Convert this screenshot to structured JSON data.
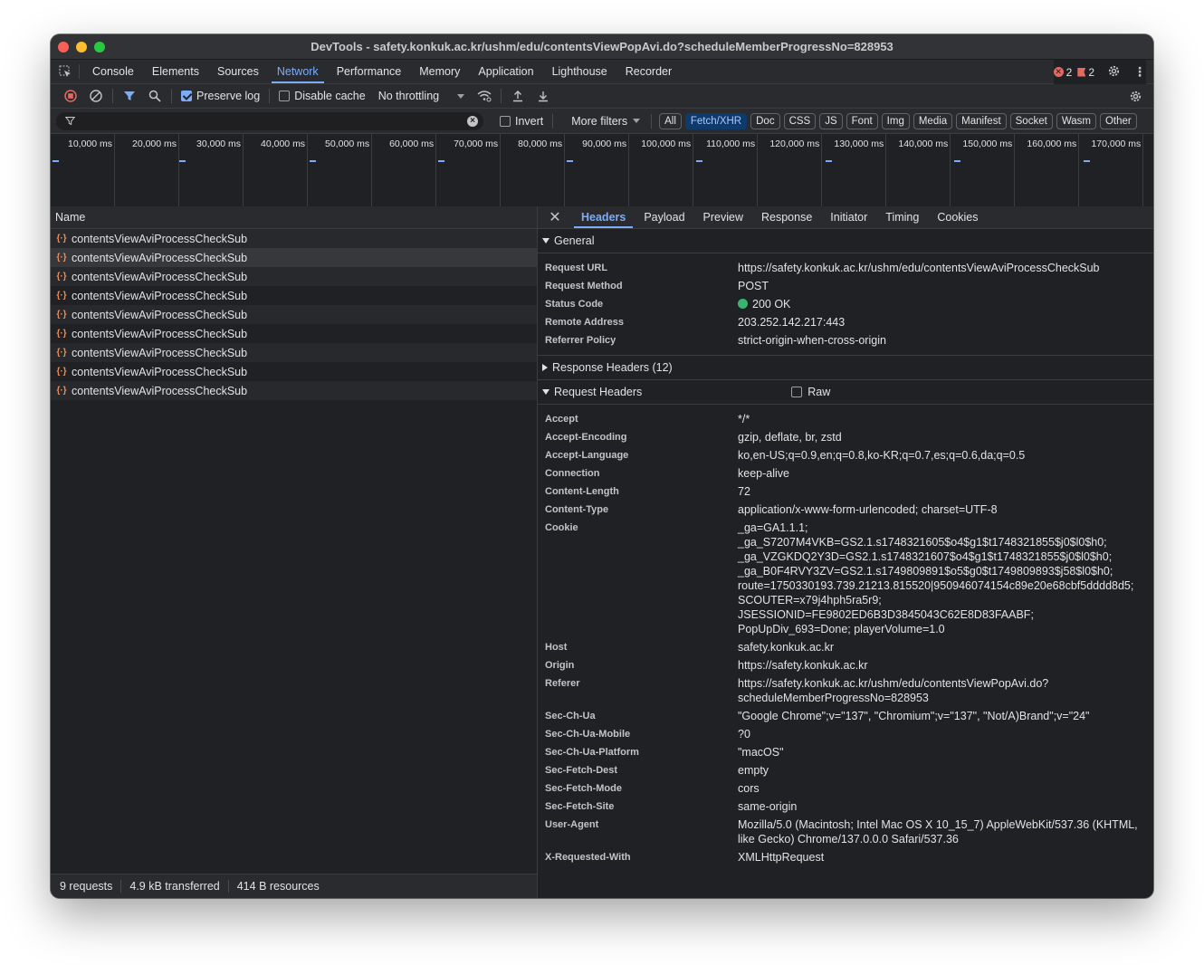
{
  "window": {
    "title": "DevTools - safety.konkuk.ac.kr/ushm/edu/contentsViewPopAvi.do?scheduleMemberProgressNo=828953"
  },
  "tabs": [
    "Console",
    "Elements",
    "Sources",
    "Network",
    "Performance",
    "Memory",
    "Application",
    "Lighthouse",
    "Recorder"
  ],
  "active_tab": "Network",
  "issues": {
    "errors": "2",
    "warnings": "2"
  },
  "toolbar": {
    "preserve_log": "Preserve log",
    "disable_cache": "Disable cache",
    "throttling": "No throttling"
  },
  "filter": {
    "placeholder": "",
    "invert": "Invert",
    "more_filters": "More filters",
    "chips": [
      "All",
      "Fetch/XHR",
      "Doc",
      "CSS",
      "JS",
      "Font",
      "Img",
      "Media",
      "Manifest",
      "Socket",
      "Wasm",
      "Other"
    ],
    "active_chip": "Fetch/XHR"
  },
  "overview": {
    "ticks": [
      "10,000 ms",
      "20,000 ms",
      "30,000 ms",
      "40,000 ms",
      "50,000 ms",
      "60,000 ms",
      "70,000 ms",
      "80,000 ms",
      "90,000 ms",
      "100,000 ms",
      "110,000 ms",
      "120,000 ms",
      "130,000 ms",
      "140,000 ms",
      "150,000 ms",
      "160,000 ms",
      "170,000 ms"
    ]
  },
  "requests": {
    "column_name": "Name",
    "items": [
      "contentsViewAviProcessCheckSub",
      "contentsViewAviProcessCheckSub",
      "contentsViewAviProcessCheckSub",
      "contentsViewAviProcessCheckSub",
      "contentsViewAviProcessCheckSub",
      "contentsViewAviProcessCheckSub",
      "contentsViewAviProcessCheckSub",
      "contentsViewAviProcessCheckSub",
      "contentsViewAviProcessCheckSub"
    ],
    "selected_index": 1
  },
  "status": {
    "requests": "9 requests",
    "transferred": "4.9 kB transferred",
    "resources": "414 B resources"
  },
  "detail_tabs": [
    "Headers",
    "Payload",
    "Preview",
    "Response",
    "Initiator",
    "Timing",
    "Cookies"
  ],
  "active_detail_tab": "Headers",
  "general": {
    "title": "General",
    "rows": [
      {
        "k": "Request URL",
        "v": "https://safety.konkuk.ac.kr/ushm/edu/contentsViewAviProcessCheckSub"
      },
      {
        "k": "Request Method",
        "v": "POST"
      },
      {
        "k": "Status Code",
        "v": "200 OK"
      },
      {
        "k": "Remote Address",
        "v": "203.252.142.217:443"
      },
      {
        "k": "Referrer Policy",
        "v": "strict-origin-when-cross-origin"
      }
    ]
  },
  "response_headers": {
    "title": "Response Headers (12)"
  },
  "request_headers": {
    "title": "Request Headers",
    "raw": "Raw",
    "rows": [
      {
        "k": "Accept",
        "v": "*/*"
      },
      {
        "k": "Accept-Encoding",
        "v": "gzip, deflate, br, zstd"
      },
      {
        "k": "Accept-Language",
        "v": "ko,en-US;q=0.9,en;q=0.8,ko-KR;q=0.7,es;q=0.6,da;q=0.5"
      },
      {
        "k": "Connection",
        "v": "keep-alive"
      },
      {
        "k": "Content-Length",
        "v": "72"
      },
      {
        "k": "Content-Type",
        "v": "application/x-www-form-urlencoded; charset=UTF-8"
      },
      {
        "k": "Cookie",
        "v": "_ga=GA1.1.1;\n_ga_S7207M4VKB=GS2.1.s1748321605$o4$g1$t1748321855$j0$l0$h0;\n_ga_VZGKDQ2Y3D=GS2.1.s1748321607$o4$g1$t1748321855$j0$l0$h0;\n_ga_B0F4RVY3ZV=GS2.1.s1749809891$o5$g0$t1749809893$j58$l0$h0;\nroute=1750330193.739.21213.815520|950946074154c89e20e68cbf5dddd8d5; SCOUTER=x79j4hph5ra5r9;\nJSESSIONID=FE9802ED6B3D3845043C62E8D83FAABF;\nPopUpDiv_693=Done; playerVolume=1.0"
      },
      {
        "k": "Host",
        "v": "safety.konkuk.ac.kr"
      },
      {
        "k": "Origin",
        "v": "https://safety.konkuk.ac.kr"
      },
      {
        "k": "Referer",
        "v": "https://safety.konkuk.ac.kr/ushm/edu/contentsViewPopAvi.do?\nscheduleMemberProgressNo=828953"
      },
      {
        "k": "Sec-Ch-Ua",
        "v": "\"Google Chrome\";v=\"137\", \"Chromium\";v=\"137\", \"Not/A)Brand\";v=\"24\""
      },
      {
        "k": "Sec-Ch-Ua-Mobile",
        "v": "?0"
      },
      {
        "k": "Sec-Ch-Ua-Platform",
        "v": "\"macOS\""
      },
      {
        "k": "Sec-Fetch-Dest",
        "v": "empty"
      },
      {
        "k": "Sec-Fetch-Mode",
        "v": "cors"
      },
      {
        "k": "Sec-Fetch-Site",
        "v": "same-origin"
      },
      {
        "k": "User-Agent",
        "v": "Mozilla/5.0 (Macintosh; Intel Mac OS X 10_15_7) AppleWebKit/537.36 (KHTML, like Gecko) Chrome/137.0.0.0 Safari/537.36"
      },
      {
        "k": "X-Requested-With",
        "v": "XMLHttpRequest"
      }
    ]
  }
}
